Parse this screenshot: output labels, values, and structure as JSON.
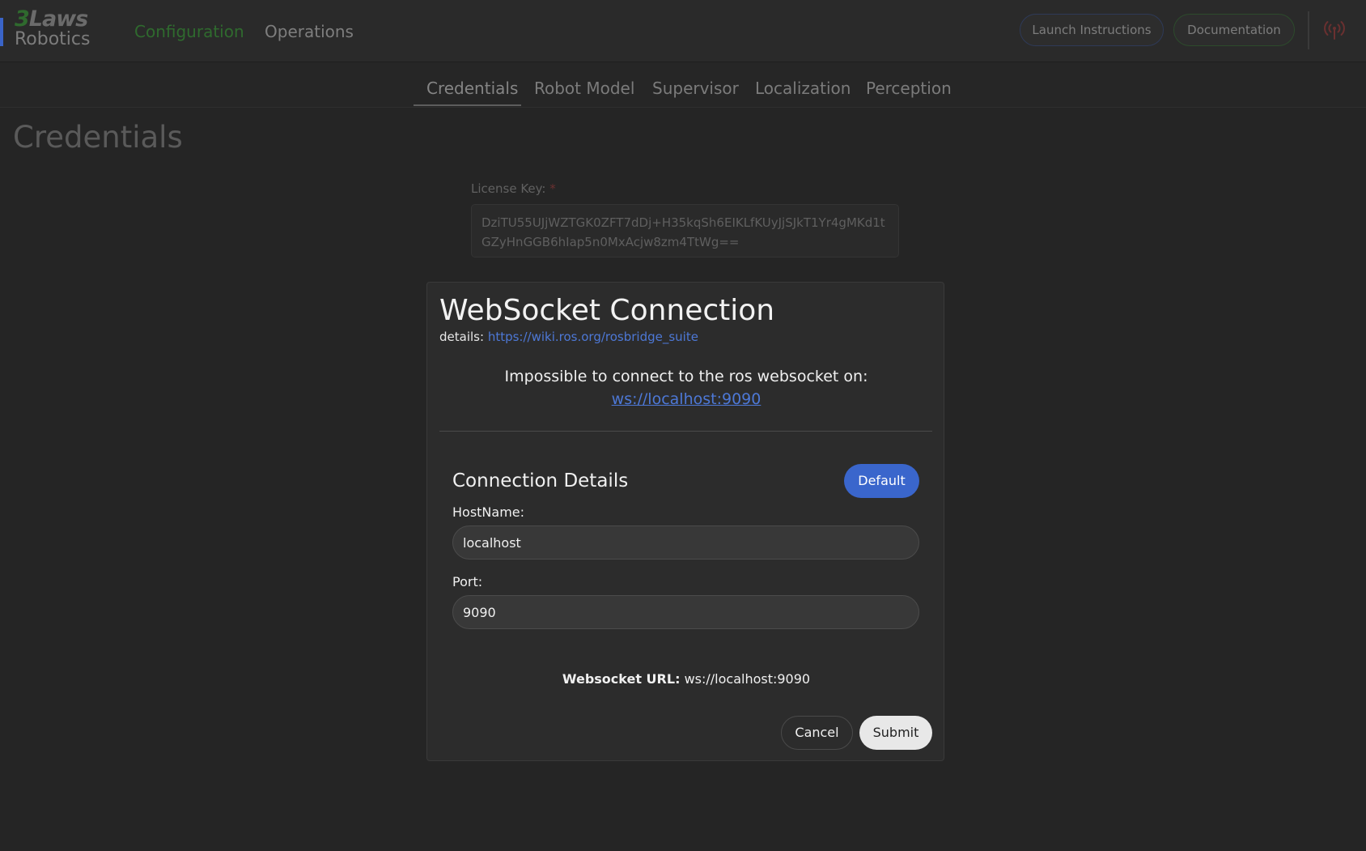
{
  "header": {
    "logo_top": "Laws",
    "logo_digit": "3",
    "logo_bottom": "Robotics",
    "nav": {
      "configuration": "Configuration",
      "operations": "Operations"
    },
    "launch_instructions": "Launch Instructions",
    "documentation": "Documentation",
    "status_icon": "signal-broadcast-icon"
  },
  "subtabs": [
    "Credentials",
    "Robot Model",
    "Supervisor",
    "Localization",
    "Perception"
  ],
  "active_subtab": "Credentials",
  "page": {
    "title": "Credentials",
    "license_label": "License Key:",
    "license_required_mark": "*",
    "license_value": "DziTU55UJjWZTGK0ZFT7dDj+H35kqSh6EIKLfKUyJjSJkT1Yr4gMKd1tGZyHnGGB6hIap5n0MxAcjw8zm4TtWg=="
  },
  "modal": {
    "title": "WebSocket Connection",
    "details_label": "details:",
    "details_link": "https://wiki.ros.org/rosbridge_suite",
    "error_message": "Impossible to connect to the ros websocket on:",
    "error_url": "ws://localhost:9090",
    "section_title": "Connection Details",
    "default_button": "Default",
    "hostname_label": "HostName:",
    "hostname_value": "localhost",
    "port_label": "Port:",
    "port_value": "9090",
    "ws_url_label": "Websocket URL:",
    "ws_url_value": "ws://localhost:9090",
    "cancel_button": "Cancel",
    "submit_button": "Submit"
  },
  "colors": {
    "accent_blue": "#3a66cc",
    "brand_green": "#2f6a2e",
    "status_red": "#6a3030"
  }
}
